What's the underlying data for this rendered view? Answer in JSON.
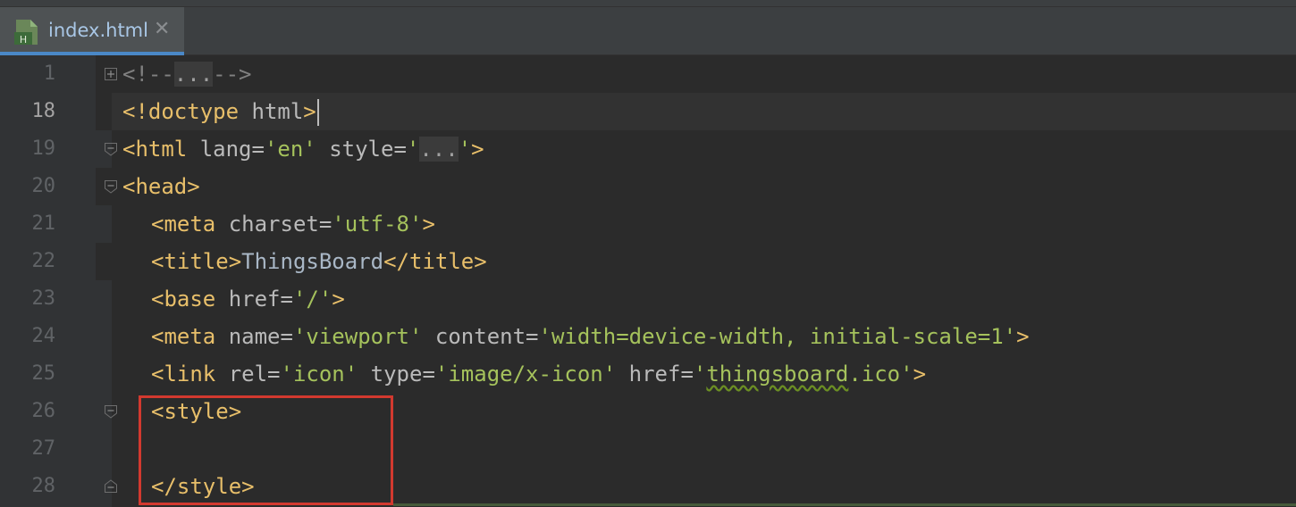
{
  "tab": {
    "filename": "index.html",
    "close_glyph": "✕",
    "icon_letter": "H"
  },
  "editor": {
    "lines": [
      {
        "number": "1",
        "fold": "plus"
      },
      {
        "number": "18",
        "current": true
      },
      {
        "number": "19",
        "fold": "minus"
      },
      {
        "number": "20",
        "fold": "minus"
      },
      {
        "number": "21"
      },
      {
        "number": "22"
      },
      {
        "number": "23"
      },
      {
        "number": "24"
      },
      {
        "number": "25"
      },
      {
        "number": "26",
        "fold": "minus"
      },
      {
        "number": "27"
      },
      {
        "number": "28",
        "fold": "end"
      }
    ],
    "code": {
      "l1_open": "<!--",
      "l1_folded": "...",
      "l1_close": "-->",
      "l18_tag": "<!doctype",
      "l18_word": " html",
      "l18_end": ">",
      "l19_tag": "<html",
      "l19_attr1": " lang=",
      "l19_val1": "'en'",
      "l19_attr2": " style=",
      "l19_q1": "'",
      "l19_folded": "...",
      "l19_q2": "'",
      "l19_end": ">",
      "l20_tag": "<head>",
      "l21_tag": "<meta",
      "l21_attr": " charset=",
      "l21_val": "'utf-8'",
      "l21_end": ">",
      "l22_open": "<title>",
      "l22_text": "ThingsBoard",
      "l22_close": "</title>",
      "l23_tag": "<base",
      "l23_attr": " href=",
      "l23_val": "'/'",
      "l23_end": ">",
      "l24_tag": "<meta",
      "l24_attr1": " name=",
      "l24_val1": "'viewport'",
      "l24_attr2": " content=",
      "l24_val2": "'width=device-width, initial-scale=1'",
      "l24_end": ">",
      "l25_tag": "<link",
      "l25_attr1": " rel=",
      "l25_val1": "'icon'",
      "l25_attr2": " type=",
      "l25_val2": "'image/x-icon'",
      "l25_attr3": " href=",
      "l25_q1": "'",
      "l25_val3": "thingsboard",
      "l25_val3b": ".ico",
      "l25_q2": "'",
      "l25_end": ">",
      "l26_tag": "<style>",
      "l28_tag": "</style>"
    }
  },
  "colors": {
    "tag": "#e8bf6a",
    "attribute": "#bababa",
    "string": "#a5c25c",
    "highlight_box": "#d2392f",
    "active_tab_underline": "#4a88c7"
  }
}
